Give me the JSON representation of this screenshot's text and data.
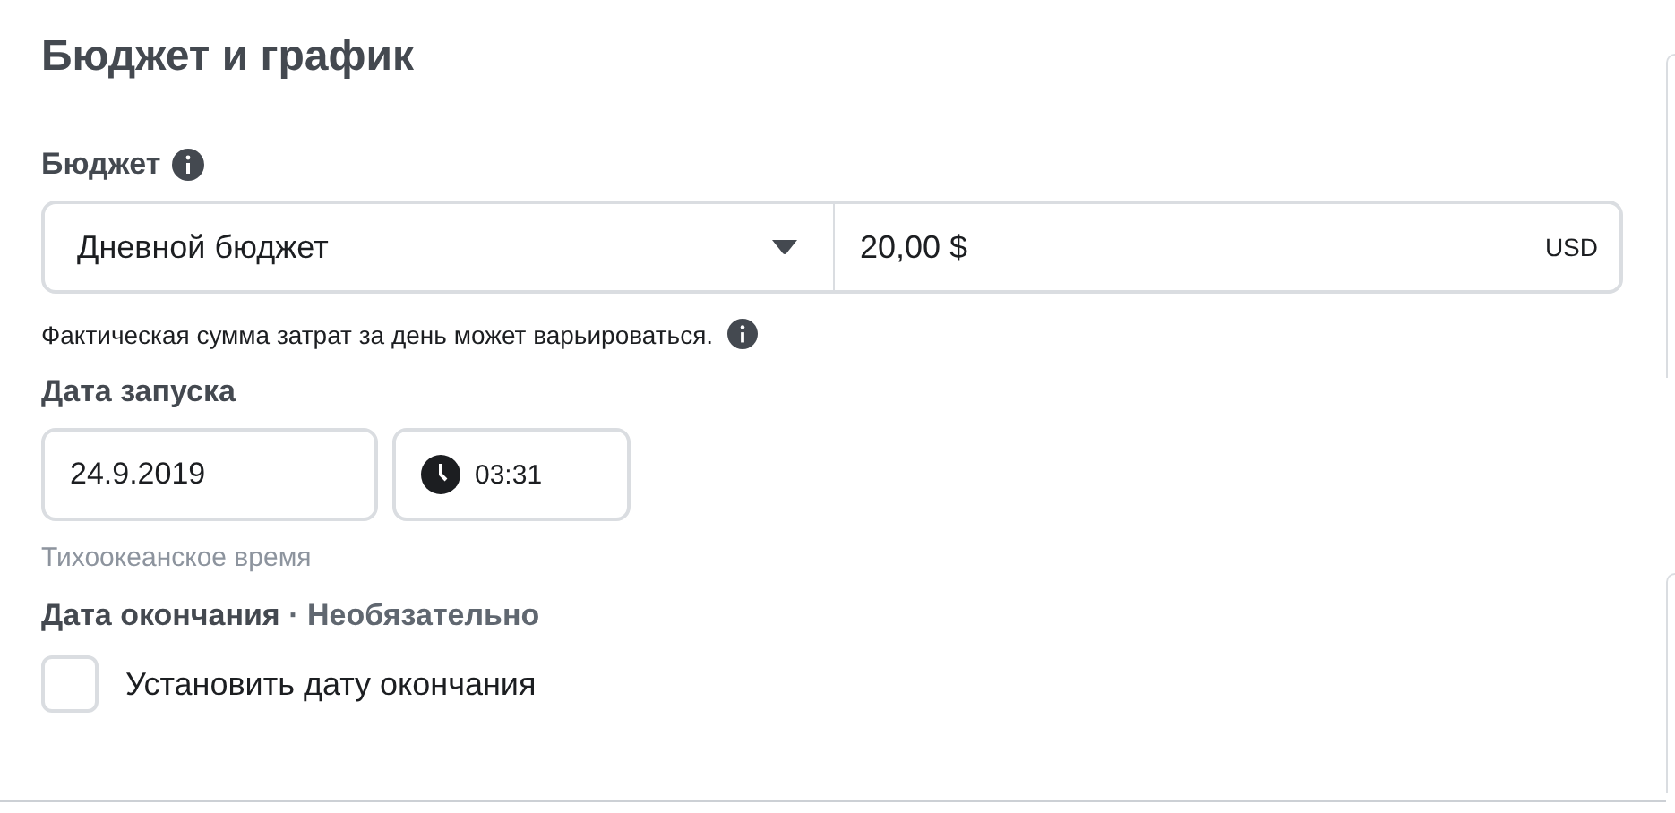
{
  "section": {
    "title": "Бюджет и график"
  },
  "budget": {
    "label": "Бюджет",
    "type_select": "Дневной бюджет",
    "amount": "20,00 $",
    "currency": "USD",
    "hint": "Фактическая сумма затрат за день может варьироваться."
  },
  "start_date": {
    "label": "Дата запуска",
    "date": "24.9.2019",
    "time": "03:31",
    "timezone": "Тихоокеанское время"
  },
  "end_date": {
    "label": "Дата окончания",
    "optional": "· Необязательно",
    "checkbox": {
      "label": "Установить дату окончания",
      "checked": false
    }
  }
}
